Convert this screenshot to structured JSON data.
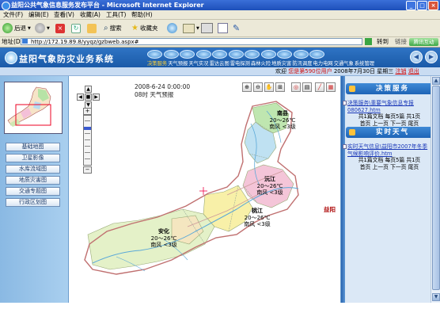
{
  "window": {
    "title": "益阳公共气象信息服务发布平台 - Microsoft Internet Explorer"
  },
  "menu": {
    "items": [
      "文件(F)",
      "编辑(E)",
      "查看(V)",
      "收藏(A)",
      "工具(T)",
      "帮助(H)"
    ]
  },
  "toolbar": {
    "back_label": "后退",
    "search_label": "搜索",
    "favorites_label": "收藏夹"
  },
  "address": {
    "label": "地址(D)",
    "url": "http://172.19.89.8/yyqz/gzbweb.aspx#",
    "go_label": "转到",
    "links_label": "链接",
    "extra_button": "腾讯互动"
  },
  "app": {
    "title": "益阳气象防灾业务系统",
    "nav": [
      "决策服务",
      "天气预报",
      "天气实况",
      "雷达云图",
      "雷电探测",
      "森林火险",
      "地质灾害",
      "防汛调度",
      "电力电网",
      "交通气象",
      "系统管理"
    ]
  },
  "welcome": {
    "text_prefix": "欢迎",
    "user_text": "您是第590位用户",
    "date": "2008年7月30日",
    "weekday": "星期三",
    "link_register": "注销",
    "link_exit": "退出"
  },
  "sidebar": {
    "buttons": [
      "基础地图",
      "卫星影像",
      "水库流域图",
      "地质灾害图",
      "交通专题图",
      "行政区划图"
    ]
  },
  "map": {
    "tooltip": "2008-6-24 0:00:00 08时 天气预报",
    "regions": [
      {
        "name": "南县",
        "temp": "20～26℃",
        "wind": "南风 <3级"
      },
      {
        "name": "沅江",
        "temp": "20～26℃",
        "wind": "南风 <3级"
      },
      {
        "name": "益阳",
        "temp": "",
        "wind": ""
      },
      {
        "name": "桃江",
        "temp": "20～26℃",
        "wind": "南风 <3级"
      },
      {
        "name": "安化",
        "temp": "20～26℃",
        "wind": "南风 <3级"
      }
    ],
    "tool_icons": [
      "zoom-in-icon",
      "zoom-out-icon",
      "pan-hand-icon",
      "full-extent-icon",
      "lifebuoy-icon",
      "print-icon",
      "eraser-icon",
      "ruler-icon"
    ]
  },
  "right": {
    "decision_title": "决策服务",
    "decision_doc": "决策服务\\重要气象信息专报080627.htm",
    "decision_pager_info": "共1篇文档  每页5篇  共1页",
    "decision_pager_nav": "首页  上一页  下一页  尾页",
    "realtime_title": "实时天气",
    "realtime_doc": "实时天气信息\\益阳市2007年冬季气候影响评价.htm",
    "realtime_pager_info": "共1篇文档  每页5篇  共1页",
    "realtime_pager_nav": "首页  上一页  下一页  尾页"
  },
  "colors": {
    "header_blue": "#1a5aa8",
    "title_bar": "#2858c8",
    "nav_highlight": "#ffd23a",
    "user_red": "#d01010"
  }
}
